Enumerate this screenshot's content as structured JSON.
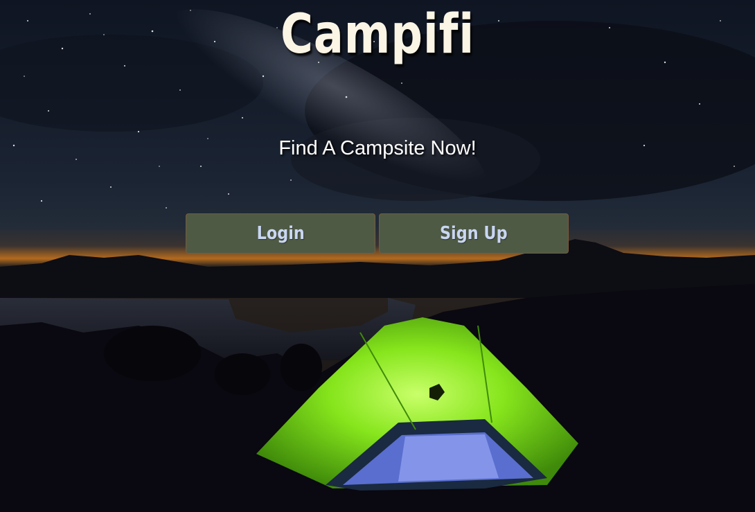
{
  "app": {
    "title": "Campifi",
    "tagline": "Find A Campsite Now!"
  },
  "actions": {
    "login_label": "Login",
    "signup_label": "Sign Up"
  },
  "colors": {
    "title_text": "#fbf5e6",
    "button_bg": "#4f5a45",
    "button_text": "#c9d6f2",
    "button_border": "#7a5a3a",
    "tent_green": "#7be21c",
    "sky": "#0d1320"
  },
  "background": {
    "icon": "night-sky-campsite-image"
  }
}
